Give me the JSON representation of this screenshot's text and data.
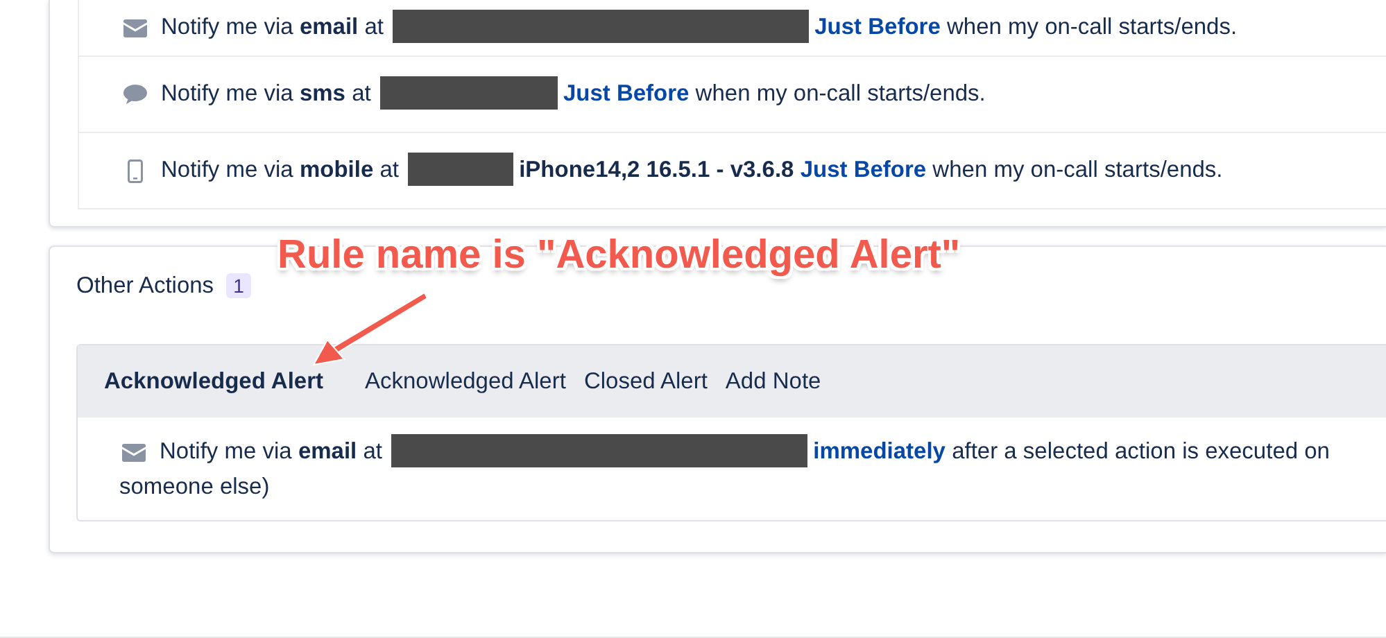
{
  "on_call_rules": [
    {
      "kind": "email",
      "text_before": "Notify me via **email** at",
      "timing": "Just Before",
      "text_after": "when my on-call starts/ends."
    },
    {
      "kind": "sms",
      "text_before": "Notify me via **sms** at",
      "timing": "Just Before",
      "text_after": "when my on-call starts/ends."
    },
    {
      "kind": "mobile",
      "text_before": "Notify me via **mobile** at",
      "device": "iPhone14,2 16.5.1 - v3.6.8",
      "timing": "Just Before",
      "text_after": "when my on-call starts/ends."
    }
  ],
  "other_actions": {
    "title": "Other Actions",
    "count": "1",
    "annotation": "Rule name is \"Acknowledged Alert\"",
    "rule_name": "Acknowledged Alert",
    "actions": [
      "Acknowledged Alert",
      "Closed Alert",
      "Add Note"
    ],
    "notification": {
      "kind": "email",
      "text_before": "Notify me via **email** at",
      "timing": "immediately",
      "text_after": "after a selected action is executed on",
      "text_continued": "someone else)"
    }
  }
}
